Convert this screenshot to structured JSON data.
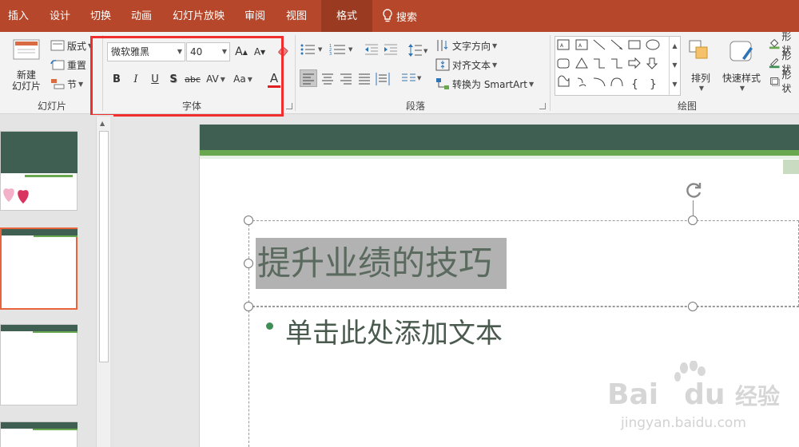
{
  "menu": {
    "tabs": [
      {
        "label": "插入",
        "active": false
      },
      {
        "label": "设计",
        "active": false
      },
      {
        "label": "切换",
        "active": false
      },
      {
        "label": "动画",
        "active": false
      },
      {
        "label": "幻灯片放映",
        "active": false
      },
      {
        "label": "审阅",
        "active": false
      },
      {
        "label": "视图",
        "active": false
      },
      {
        "label": "格式",
        "active": true
      }
    ],
    "search_label": "搜索"
  },
  "ribbon": {
    "slides_group": {
      "new_slide_line1": "新建",
      "new_slide_line2": "幻灯片",
      "layout_label": "版式",
      "reset_label": "重置",
      "section_label": "节",
      "group_label": "幻灯片"
    },
    "font_group": {
      "font_name": "微软雅黑",
      "font_size": "40",
      "grow_label": "A",
      "shrink_label": "A",
      "bold": "B",
      "italic": "I",
      "underline": "U",
      "shadow": "S",
      "strikethrough": "abc",
      "spacing": "AV",
      "change_case": "Aa",
      "font_color": "A",
      "font_color_value": "#e02020",
      "group_label": "字体"
    },
    "paragraph_group": {
      "text_direction": "文字方向",
      "align_text": "对齐文本",
      "convert_smartart": "转换为 SmartArt",
      "group_label": "段落"
    },
    "drawing_group": {
      "arrange_label": "排列",
      "quick_styles_label": "快速样式",
      "shape_fill": "形状",
      "shape_outline": "形状",
      "shape_effects": "形状",
      "group_label": "绘图"
    }
  },
  "slide": {
    "title": "提升业绩的技巧",
    "body_placeholder": "单击此处添加文本"
  },
  "watermark": {
    "brand": "Bai",
    "brand2": "du",
    "suffix": "经验",
    "url": "jingyan.baidu.com"
  },
  "colors": {
    "menu_bar": "#b7472a",
    "active_tab": "#9a3a21",
    "highlight": "#f02e2e",
    "slide_header": "#3f5f52",
    "slide_accent": "#6aa84f"
  }
}
